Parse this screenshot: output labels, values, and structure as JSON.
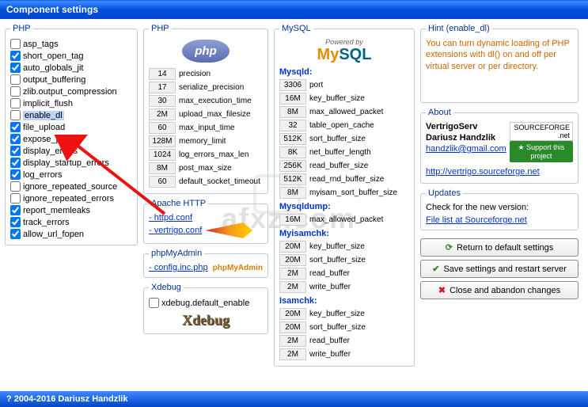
{
  "window": {
    "title": "Component settings"
  },
  "php_checks": {
    "legend": "PHP",
    "items": [
      {
        "label": "asp_tags",
        "checked": false
      },
      {
        "label": "short_open_tag",
        "checked": true
      },
      {
        "label": "auto_globals_jit",
        "checked": true
      },
      {
        "label": "output_buffering",
        "checked": false
      },
      {
        "label": "zlib.output_compression",
        "checked": false
      },
      {
        "label": "implicit_flush",
        "checked": false
      },
      {
        "label": "enable_dl",
        "checked": false,
        "highlight": true
      },
      {
        "label": "file_upload",
        "checked": true
      },
      {
        "label": "expose_php",
        "checked": true
      },
      {
        "label": "display_errors",
        "checked": true
      },
      {
        "label": "display_startup_errors",
        "checked": true
      },
      {
        "label": "log_errors",
        "checked": true
      },
      {
        "label": "ignore_repeated_source",
        "checked": false
      },
      {
        "label": "ignore_repeated_errors",
        "checked": false
      },
      {
        "label": "report_memleaks",
        "checked": true
      },
      {
        "label": "track_errors",
        "checked": true
      },
      {
        "label": "allow_url_fopen",
        "checked": true
      }
    ]
  },
  "php_vals": {
    "legend": "PHP",
    "items": [
      {
        "val": "14",
        "label": "precision"
      },
      {
        "val": "17",
        "label": "serialize_precision"
      },
      {
        "val": "30",
        "label": "max_execution_time"
      },
      {
        "val": "2M",
        "label": "upload_max_filesize"
      },
      {
        "val": "60",
        "label": "max_input_time"
      },
      {
        "val": "128M",
        "label": "memory_limit"
      },
      {
        "val": "1024",
        "label": "log_errors_max_len"
      },
      {
        "val": "8M",
        "label": "post_max_size"
      },
      {
        "val": "60",
        "label": "default_socket_timeout"
      }
    ]
  },
  "apache": {
    "legend": "Apache HTTP",
    "links": [
      "- httpd.conf",
      "- vertrigo.conf"
    ]
  },
  "pma": {
    "legend": "phpMyAdmin",
    "link": "- config.inc.php",
    "brand": "phpMyAdmin"
  },
  "xdebug": {
    "legend": "Xdebug",
    "chk": "xdebug.default_enable",
    "brand": "Xdebug"
  },
  "mysql": {
    "legend": "MySQL",
    "powered": "Powered by",
    "mysqld": {
      "title": "Mysqld:",
      "items": [
        {
          "val": "3306",
          "label": "port"
        },
        {
          "val": "16M",
          "label": "key_buffer_size"
        },
        {
          "val": "8M",
          "label": "max_allowed_packet"
        },
        {
          "val": "32",
          "label": "table_open_cache"
        },
        {
          "val": "512K",
          "label": "sort_buffer_size"
        },
        {
          "val": "8K",
          "label": "net_buffer_length"
        },
        {
          "val": "256K",
          "label": "read_buffer_size"
        },
        {
          "val": "512K",
          "label": "read_rnd_buffer_size"
        },
        {
          "val": "8M",
          "label": "myisam_sort_buffer_size"
        }
      ]
    },
    "mysqldump": {
      "title": "Mysqldump:",
      "items": [
        {
          "val": "16M",
          "label": "max_allowed_packet"
        }
      ]
    },
    "myisamchk": {
      "title": "Myisamchk:",
      "items": [
        {
          "val": "20M",
          "label": "key_buffer_size"
        },
        {
          "val": "20M",
          "label": "sort_buffer_size"
        },
        {
          "val": "2M",
          "label": "read_buffer"
        },
        {
          "val": "2M",
          "label": "write_buffer"
        }
      ]
    },
    "isamchk": {
      "title": "Isamchk:",
      "items": [
        {
          "val": "20M",
          "label": "key_buffer_size"
        },
        {
          "val": "20M",
          "label": "sort_buffer_size"
        },
        {
          "val": "2M",
          "label": "read_buffer"
        },
        {
          "val": "2M",
          "label": "write_buffer"
        }
      ]
    }
  },
  "hint": {
    "legend": "Hint (enable_dl)",
    "text": "You can turn dynamic loading of PHP extensions with dl() on and off per virtual server or per directory."
  },
  "about": {
    "legend": "About",
    "product": "VertrigoServ",
    "author": "Dariusz Handzlik",
    "email": "handzlik@gmail.com",
    "url": "http://vertrigo.sourceforge.net",
    "sf": "SOURCEFORGE .net",
    "support": "Support this project"
  },
  "updates": {
    "legend": "Updates",
    "text": "Check for the new version:",
    "link": "File list at Sourceforge.net"
  },
  "buttons": {
    "reset": "Return to default settings",
    "save": "Save settings and restart server",
    "cancel": "Close and abandon changes"
  },
  "footer": "? 2004-2016 Dariusz Handzlik"
}
